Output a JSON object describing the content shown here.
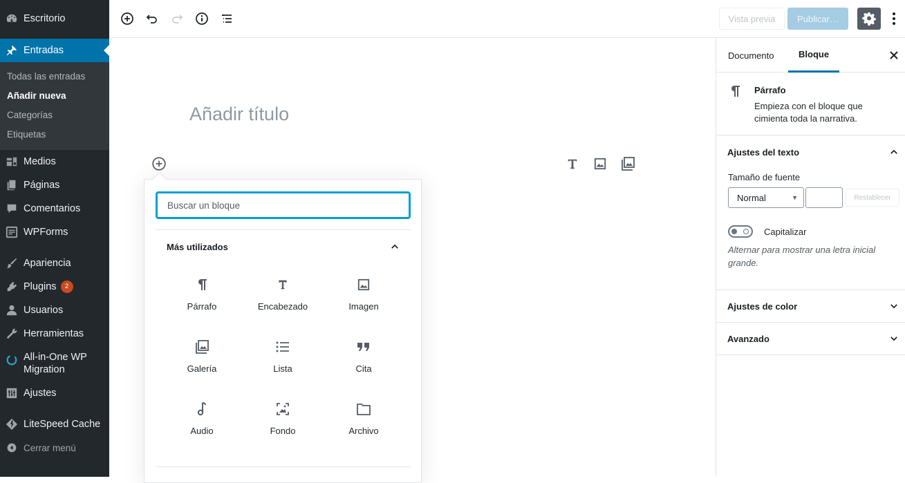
{
  "admin_menu": {
    "items": [
      {
        "key": "dashboard",
        "label": "Escritorio",
        "icon": "dashboard-icon"
      },
      {
        "key": "posts",
        "label": "Entradas",
        "icon": "pushpin-icon",
        "active": true
      },
      {
        "key": "media",
        "label": "Medios",
        "icon": "media-icon"
      },
      {
        "key": "pages",
        "label": "Páginas",
        "icon": "pages-icon"
      },
      {
        "key": "comments",
        "label": "Comentarios",
        "icon": "comments-icon"
      },
      {
        "key": "wpforms",
        "label": "WPForms",
        "icon": "wpforms-icon"
      },
      {
        "key": "appearance",
        "label": "Apariencia",
        "icon": "paintbrush-icon"
      },
      {
        "key": "plugins",
        "label": "Plugins",
        "icon": "plugins-icon",
        "badge": "2"
      },
      {
        "key": "users",
        "label": "Usuarios",
        "icon": "users-icon"
      },
      {
        "key": "tools",
        "label": "Herramientas",
        "icon": "wrench-icon"
      },
      {
        "key": "migration",
        "label": "All-in-One WP Migration",
        "icon": "migration-icon"
      },
      {
        "key": "settings",
        "label": "Ajustes",
        "icon": "settings-sliders-icon"
      },
      {
        "key": "litespeed",
        "label": "LiteSpeed Cache",
        "icon": "litespeed-icon"
      },
      {
        "key": "collapse",
        "label": "Cerrar menú",
        "icon": "collapse-arrow-icon"
      }
    ],
    "submenu": [
      {
        "label": "Todas las entradas"
      },
      {
        "label": "Añadir nueva",
        "current": true
      },
      {
        "label": "Categorías"
      },
      {
        "label": "Etiquetas"
      }
    ]
  },
  "toolbar": {
    "preview_label": "Vista previa",
    "publish_label": "Publicar…",
    "icons": [
      "add-block-icon",
      "undo-icon",
      "redo-icon",
      "info-icon",
      "block-navigation-icon",
      "gear-icon",
      "more-vertical-icon"
    ]
  },
  "editor": {
    "title_placeholder": "Añadir título"
  },
  "inserter": {
    "search_placeholder": "Buscar un bloque",
    "category_label": "Más utilizados",
    "blocks": [
      {
        "label": "Párrafo",
        "icon": "paragraph-icon"
      },
      {
        "label": "Encabezado",
        "icon": "heading-icon"
      },
      {
        "label": "Imagen",
        "icon": "image-icon"
      },
      {
        "label": "Galería",
        "icon": "gallery-icon"
      },
      {
        "label": "Lista",
        "icon": "list-icon"
      },
      {
        "label": "Cita",
        "icon": "quote-icon"
      },
      {
        "label": "Audio",
        "icon": "audio-icon"
      },
      {
        "label": "Fondo",
        "icon": "cover-icon"
      },
      {
        "label": "Archivo",
        "icon": "file-folder-icon"
      }
    ]
  },
  "panel": {
    "tabs": [
      {
        "label": "Documento"
      },
      {
        "label": "Bloque",
        "active": true
      }
    ],
    "block_card": {
      "title": "Párrafo",
      "description": "Empieza con el bloque que cimienta toda la narrativa."
    },
    "text_settings": {
      "title": "Ajustes del texto",
      "font_size_label": "Tamaño de fuente",
      "font_size_value": "Normal",
      "reset_label": "Restablecer",
      "dropcap_label": "Capitalizar",
      "dropcap_help": "Alternar para mostrar una letra inicial grande.",
      "dropcap_enabled": false
    },
    "color_settings_title": "Ajustes de color",
    "advanced_title": "Avanzado"
  },
  "colors": {
    "sidebar_bg": "#23282d",
    "active_blue": "#0073aa",
    "focus_blue": "#00a0d2",
    "badge_orange": "#ca4a1f"
  }
}
